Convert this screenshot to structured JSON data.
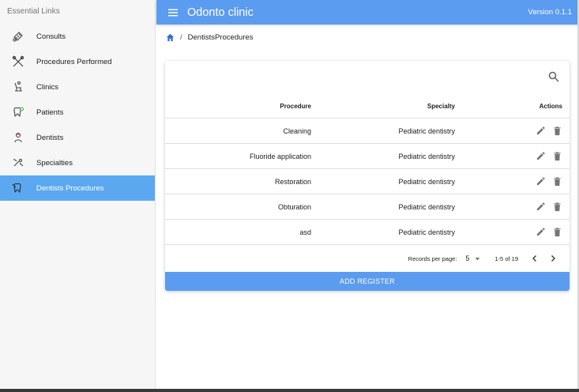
{
  "drawer": {
    "header": "Essential Links",
    "items": [
      {
        "label": "Consults",
        "icon": "consults-icon"
      },
      {
        "label": "Procedures Performed",
        "icon": "procedures-icon"
      },
      {
        "label": "Clinics",
        "icon": "clinic-chair-icon"
      },
      {
        "label": "Patients",
        "icon": "tooth-icon"
      },
      {
        "label": "Dentists",
        "icon": "dentist-icon"
      },
      {
        "label": "Specialties",
        "icon": "specialties-icon"
      },
      {
        "label": "Dentists Procedures",
        "icon": "tooth-procedure-icon",
        "active": true
      }
    ]
  },
  "header": {
    "title": "Odonto clinic",
    "version": "Version 0.1.1"
  },
  "breadcrumb": {
    "current": "DentistsProcedures"
  },
  "table": {
    "columns": {
      "procedure": "Procedure",
      "specialty": "Specialty",
      "actions": "Actions"
    },
    "rows": [
      {
        "procedure": "Cleaning",
        "specialty": "Pediatric dentistry"
      },
      {
        "procedure": "Fluoride application",
        "specialty": "Pediatric dentistry"
      },
      {
        "procedure": "Restoration",
        "specialty": "Pediatric dentistry"
      },
      {
        "procedure": "Obturation",
        "specialty": "Pediatric dentistry"
      },
      {
        "procedure": "asd",
        "specialty": "Pediatric dentistry"
      }
    ]
  },
  "pagination": {
    "records_per_page_label": "Records per page:",
    "records_per_page": "5",
    "range": "1-5 of 19"
  },
  "add_button": "ADD REGISTER",
  "colors": {
    "primary": "#5b9bf0",
    "drawer_active": "#5ba8f0",
    "drawer_bg": "#f6f6f6"
  }
}
